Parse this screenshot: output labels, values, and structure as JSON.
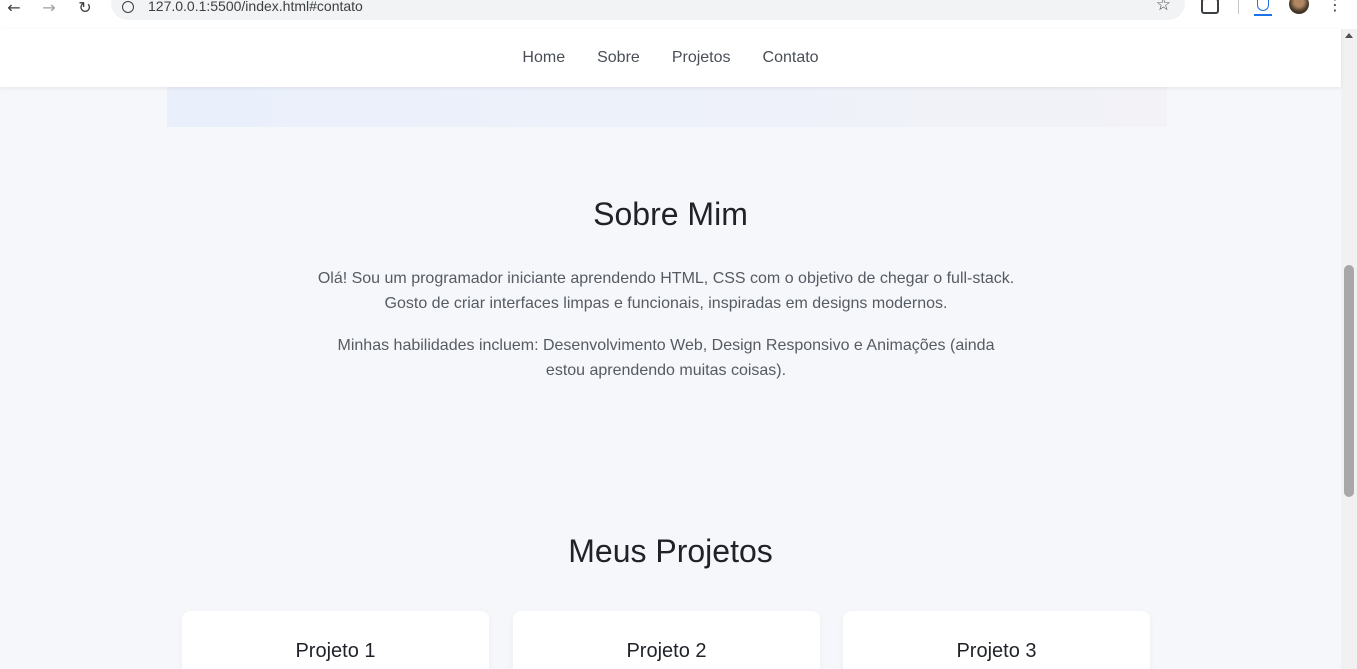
{
  "browser": {
    "url": "127.0.0.1:5500/index.html#contato",
    "icons": {
      "back": "back-arrow-icon",
      "forward": "forward-arrow-icon",
      "reload": "reload-icon",
      "site_info": "site-info-icon",
      "bookmark": "star-icon",
      "extensions": "puzzle-icon",
      "downloads": "download-icon",
      "menu": "kebab-menu-icon"
    }
  },
  "nav": {
    "items": [
      "Home",
      "Sobre",
      "Projetos",
      "Contato"
    ]
  },
  "about": {
    "title": "Sobre Mim",
    "paragraph1_line1": "Olá! Sou um programador iniciante aprendendo HTML, CSS com o objetivo de chegar o full-stack.",
    "paragraph1_line2": "Gosto de criar interfaces limpas e funcionais, inspiradas em designs modernos.",
    "paragraph2": "Minhas habilidades incluem: Desenvolvimento Web, Design Responsivo e Animações (ainda estou aprendendo muitas coisas)."
  },
  "projects": {
    "title": "Meus Projetos",
    "cards": [
      "Projeto 1",
      "Projeto 2",
      "Projeto 3"
    ]
  },
  "colors": {
    "page_bg": "#f6f7fa",
    "header_bg": "#ffffff",
    "text_dark": "#1f2228",
    "text_muted": "#555b63"
  }
}
